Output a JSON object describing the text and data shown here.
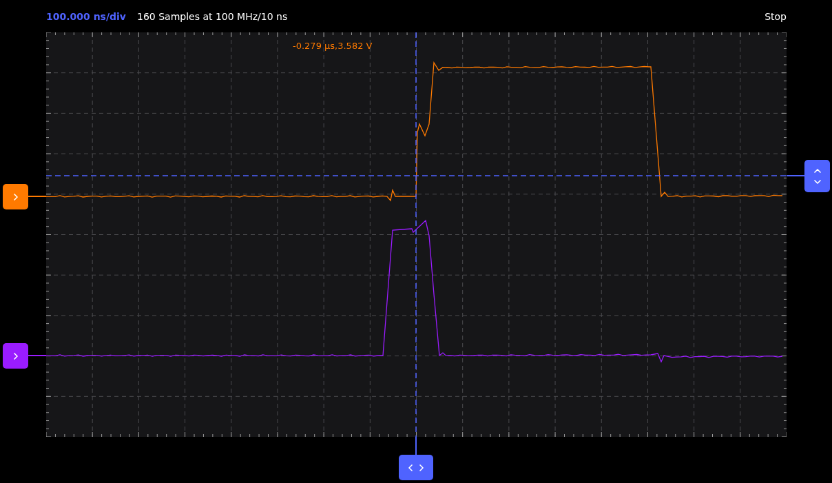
{
  "header": {
    "timebase": "100.000 ns/div",
    "acquisition": "160 Samples at 100 MHz/10 ns",
    "status": "Stop"
  },
  "cursor_readout": "-0.279 µs,3.582 V",
  "channels": [
    {
      "color": "#ff7a00"
    },
    {
      "color": "#9a1cff"
    }
  ]
}
